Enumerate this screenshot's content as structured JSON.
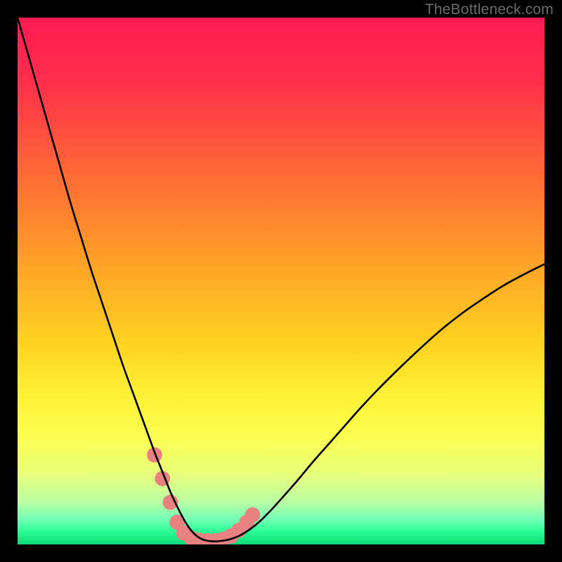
{
  "watermark": "TheBottleneck.com",
  "colors": {
    "frame": "#000000",
    "curve": "#000000",
    "marker": "#e8817f",
    "gradient_stops": [
      {
        "offset": 0.0,
        "color": "#ff1b52"
      },
      {
        "offset": 0.12,
        "color": "#ff2e4b"
      },
      {
        "offset": 0.3,
        "color": "#ff6a35"
      },
      {
        "offset": 0.46,
        "color": "#ffa027"
      },
      {
        "offset": 0.62,
        "color": "#ffd321"
      },
      {
        "offset": 0.72,
        "color": "#fff236"
      },
      {
        "offset": 0.8,
        "color": "#fbff52"
      },
      {
        "offset": 0.87,
        "color": "#e6ff7e"
      },
      {
        "offset": 0.92,
        "color": "#b8ffa4"
      },
      {
        "offset": 0.955,
        "color": "#6dffb6"
      },
      {
        "offset": 0.975,
        "color": "#2bff95"
      },
      {
        "offset": 1.0,
        "color": "#0dd877"
      }
    ]
  },
  "chart_data": {
    "type": "line",
    "title": "",
    "xlabel": "",
    "ylabel": "",
    "xlim": [
      0,
      100
    ],
    "ylim": [
      0,
      100
    ],
    "x": [
      0,
      2,
      4,
      6,
      8,
      10,
      12,
      14,
      16,
      18,
      20,
      22,
      24,
      26,
      27,
      28,
      29,
      30,
      31,
      32,
      33,
      34,
      35,
      36,
      37,
      38,
      40,
      42,
      44,
      46,
      48,
      50,
      53,
      56,
      59,
      62,
      65,
      68,
      72,
      76,
      80,
      84,
      88,
      92,
      96,
      100
    ],
    "series": [
      {
        "name": "bottleneck-curve",
        "values": [
          100,
          93,
          86,
          79,
          72,
          65,
          58.5,
          52,
          46,
          40,
          34,
          28.5,
          23,
          17.5,
          15,
          12.5,
          10,
          7.8,
          5.8,
          4.0,
          2.6,
          1.6,
          1.0,
          0.7,
          0.6,
          0.6,
          0.9,
          1.6,
          2.8,
          4.4,
          6.4,
          8.6,
          12.0,
          15.6,
          19.0,
          22.4,
          25.8,
          29.0,
          33.0,
          36.8,
          40.4,
          43.6,
          46.4,
          49.0,
          51.2,
          53.2
        ]
      }
    ],
    "markers": {
      "name": "highlighted-range",
      "points": [
        {
          "x": 26.0,
          "y": 17.0
        },
        {
          "x": 27.5,
          "y": 12.5
        },
        {
          "x": 29.0,
          "y": 8.0
        },
        {
          "x": 30.3,
          "y": 4.2
        },
        {
          "x": 31.5,
          "y": 2.2
        },
        {
          "x": 33.0,
          "y": 1.2
        },
        {
          "x": 34.5,
          "y": 0.8
        },
        {
          "x": 36.0,
          "y": 0.7
        },
        {
          "x": 37.5,
          "y": 0.7
        },
        {
          "x": 39.0,
          "y": 1.0
        },
        {
          "x": 40.5,
          "y": 1.6
        },
        {
          "x": 42.0,
          "y": 2.7
        },
        {
          "x": 43.5,
          "y": 4.2
        },
        {
          "x": 44.6,
          "y": 5.6
        }
      ]
    }
  }
}
